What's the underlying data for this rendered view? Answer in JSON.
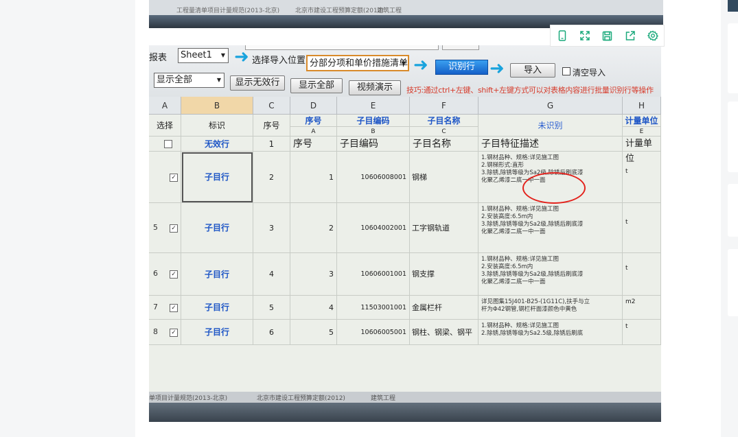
{
  "photo_top": {
    "caption_items": [
      "工程量清单项目计量规范(2013-北京)",
      "北京市建设工程预算定额(2012)",
      "建筑工程"
    ]
  },
  "toolbar_icons": [
    "mobile-preview-icon",
    "fullscreen-icon",
    "save-icon",
    "share-icon",
    "settings-icon"
  ],
  "import_panel": {
    "report_label": "报表",
    "sheet_select": "Sheet1",
    "position_label": "选择导入位置",
    "position_select": "分部分项和单价措施清单",
    "identify_button": "识别行",
    "import_button": "导入",
    "clear_import_label": "清空导入",
    "filter_select": "显示全部",
    "show_invalid_button": "显示无效行",
    "show_all_button": "显示全部",
    "video_button": "视频演示",
    "tip": "技巧:通过ctrl+左键、shift+左键方式可以对表格内容进行批量识别行等操作"
  },
  "sheet": {
    "col_letters": [
      "A",
      "B",
      "C",
      "D",
      "E",
      "F",
      "G",
      "H"
    ],
    "header_row1": [
      "选择",
      "标识",
      "序号",
      "序号",
      "子目编码",
      "子目名称",
      "未识别",
      "计量单位"
    ],
    "header_row1_sub": [
      "",
      "",
      "",
      "A",
      "B",
      "C",
      "D",
      "E"
    ],
    "invalid_row": [
      "",
      "无效行",
      "1",
      "序号",
      "子目编码",
      "子目名称",
      "子目特征描述",
      "计量单位"
    ],
    "rows": [
      {
        "num": "",
        "mark": "子目行",
        "idx": "2",
        "seq": "1",
        "code": "10606008001",
        "name": "钢梯",
        "desc": [
          "1.钢材品种、规格:详见施工图",
          "2.钢梯形式:直形",
          "3.除锈,除锈等级为Sa2级,除锈后刷底漆",
          "化聚乙烯漆二底一中一面"
        ],
        "unit": "t"
      },
      {
        "num": "5",
        "mark": "子目行",
        "idx": "3",
        "seq": "2",
        "code": "10604002001",
        "name": "工字钢轨道",
        "desc": [
          "1.钢材品种、规格:详见施工图",
          "2.安装高度:6.5m内",
          "3.除锈,除锈等级为Sa2级,除锈后刷底漆",
          "化聚乙烯漆二底一中一面"
        ],
        "unit": "t"
      },
      {
        "num": "6",
        "mark": "子目行",
        "idx": "4",
        "seq": "3",
        "code": "10606001001",
        "name": "钢支撑",
        "desc": [
          "1.钢材品种、规格:详见施工图",
          "2.安装高度:6.5m内",
          "3.除锈,除锈等级为Sa2级,除锈后刷底漆",
          "化聚乙烯漆二底一中一面"
        ],
        "unit": "t"
      },
      {
        "num": "7",
        "mark": "子目行",
        "idx": "5",
        "seq": "4",
        "code": "11503001001",
        "name": "金属栏杆",
        "desc": [
          "详见图集15J401-B25-(1G11C),扶手与立",
          "杆为Φ42钢管,钢栏杆面漆颜色中黄色"
        ],
        "unit": "m2"
      },
      {
        "num": "8",
        "mark": "子目行",
        "idx": "6",
        "seq": "5",
        "code": "10606005001",
        "name": "钢柱、钢梁、钢平",
        "desc": [
          "1.钢材品种、规格:详见施工图",
          "2.除锈,除锈等级为Sa2.5级,除锈后刷底"
        ],
        "unit": "t"
      }
    ]
  },
  "photo_bottom": {
    "caption_items": [
      "单项目计量规范(2013-北京)",
      "北京市建设工程预算定额(2012)",
      "建筑工程"
    ]
  },
  "colors": {
    "accent_blue": "#1d55c6",
    "highlight_red": "#e3221c",
    "toolbar_green": "#1aa97b"
  }
}
